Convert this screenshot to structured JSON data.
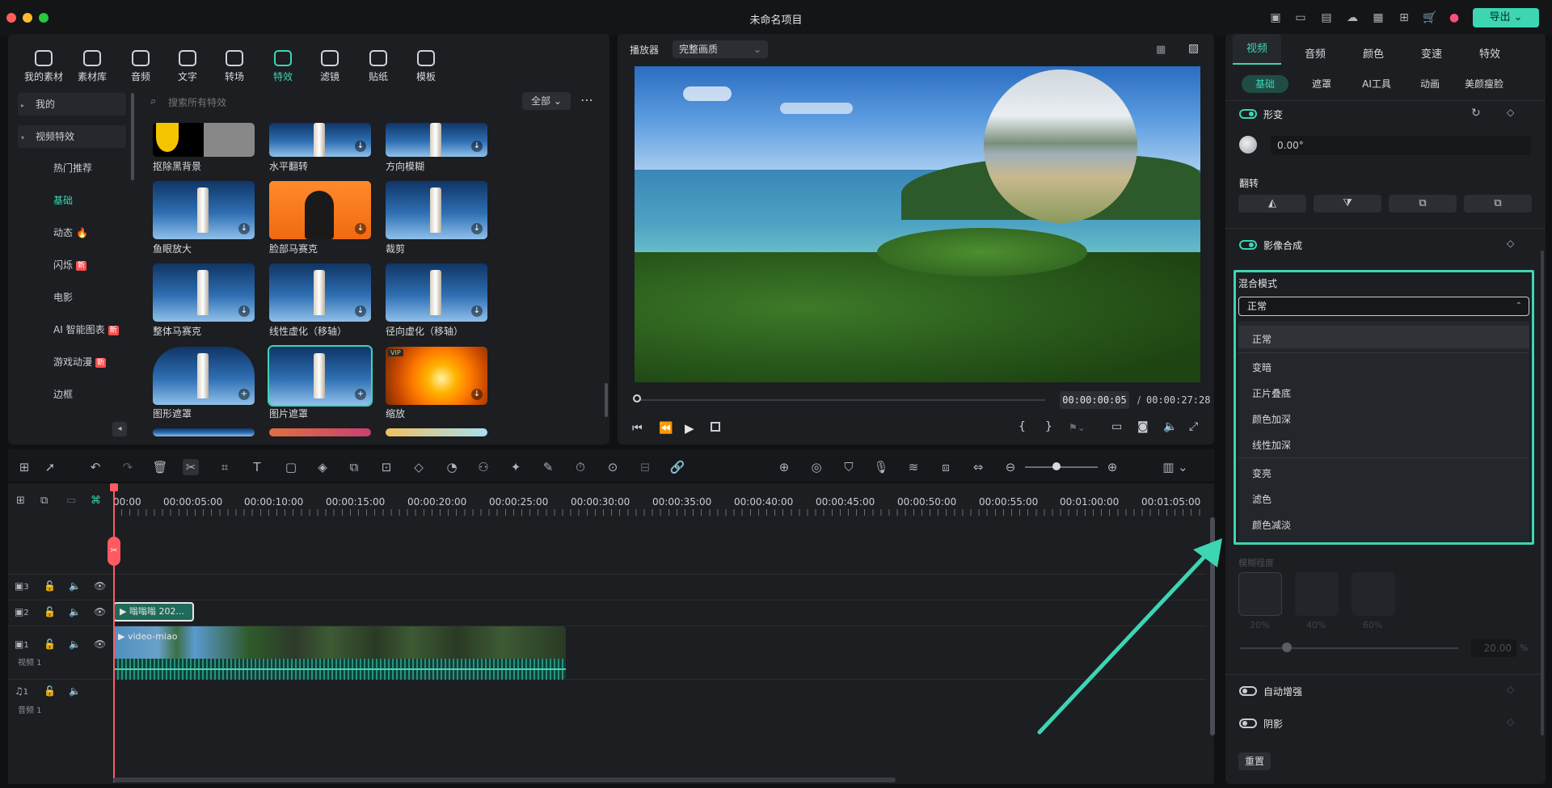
{
  "window": {
    "title": "未命名项目",
    "export_label": "导出"
  },
  "library_tabs": [
    {
      "label": "我的素材"
    },
    {
      "label": "素材库"
    },
    {
      "label": "音频"
    },
    {
      "label": "文字"
    },
    {
      "label": "转场"
    },
    {
      "label": "特效"
    },
    {
      "label": "滤镜"
    },
    {
      "label": "贴纸"
    },
    {
      "label": "模板"
    }
  ],
  "sidebar": {
    "items": [
      {
        "label": "我的"
      },
      {
        "label": "视频特效"
      },
      {
        "label": "热门推荐"
      },
      {
        "label": "基础"
      },
      {
        "label": "动态"
      },
      {
        "label": "闪烁",
        "badge": "新"
      },
      {
        "label": "电影"
      },
      {
        "label": "AI 智能图表",
        "badge": "新"
      },
      {
        "label": "游戏动漫",
        "badge": "新"
      },
      {
        "label": "边框"
      }
    ]
  },
  "search": {
    "placeholder": "搜索所有特效",
    "filter": "全部"
  },
  "effects": [
    {
      "label": "抠除黑背景"
    },
    {
      "label": "水平翻转"
    },
    {
      "label": "方向模糊"
    },
    {
      "label": "鱼眼放大"
    },
    {
      "label": "脸部马赛克"
    },
    {
      "label": "裁剪"
    },
    {
      "label": "整体马赛克"
    },
    {
      "label": "线性虚化（移轴）"
    },
    {
      "label": "径向虚化（移轴）"
    },
    {
      "label": "图形遮罩"
    },
    {
      "label": "图片遮罩"
    },
    {
      "label": "缩放",
      "tag": "VIP"
    }
  ],
  "player": {
    "label": "播放器",
    "quality": "完整画质",
    "current_time": "00:00:00:05",
    "separator": "/",
    "total_time": "00:00:27:28"
  },
  "timeline": {
    "ruler": [
      "00:00",
      "00:00:05:00",
      "00:00:10:00",
      "00:00:15:00",
      "00:00:20:00",
      "00:00:25:00",
      "00:00:30:00",
      "00:00:35:00",
      "00:00:40:00",
      "00:00:45:00",
      "00:00:50:00",
      "00:00:55:00",
      "00:01:00:00",
      "00:01:05:00"
    ],
    "tracks": [
      {
        "number": "3"
      },
      {
        "number": "2",
        "clip": "嗡嗡嗡 202..."
      },
      {
        "number": "1",
        "name": "视频 1",
        "clip": "video-miao"
      },
      {
        "number": "1",
        "name": "音频 1"
      }
    ]
  },
  "properties": {
    "tabs": [
      "视频",
      "音频",
      "颜色",
      "变速",
      "特效"
    ],
    "subtabs": [
      "基础",
      "遮罩",
      "AI工具",
      "动画",
      "美颜瘦脸"
    ],
    "transform_label": "形变",
    "rotation_value": "0.00°",
    "flip_label": "翻转",
    "composite_label": "影像合成",
    "blend_mode_label": "混合模式",
    "blend_mode_value": "正常",
    "blend_options": [
      "正常",
      "变暗",
      "正片叠底",
      "颜色加深",
      "线性加深",
      "变亮",
      "滤色",
      "颜色减淡"
    ],
    "blur_label": "模糊程度",
    "blur_presets": [
      "20%",
      "40%",
      "60%"
    ],
    "blur_value": "20.00",
    "blur_unit": "%",
    "auto_enhance_label": "自动增强",
    "shadow_label": "阴影",
    "reset_label": "重置"
  },
  "colors": {
    "accent": "#3ed5b3",
    "playhead": "#ff5a5f"
  }
}
